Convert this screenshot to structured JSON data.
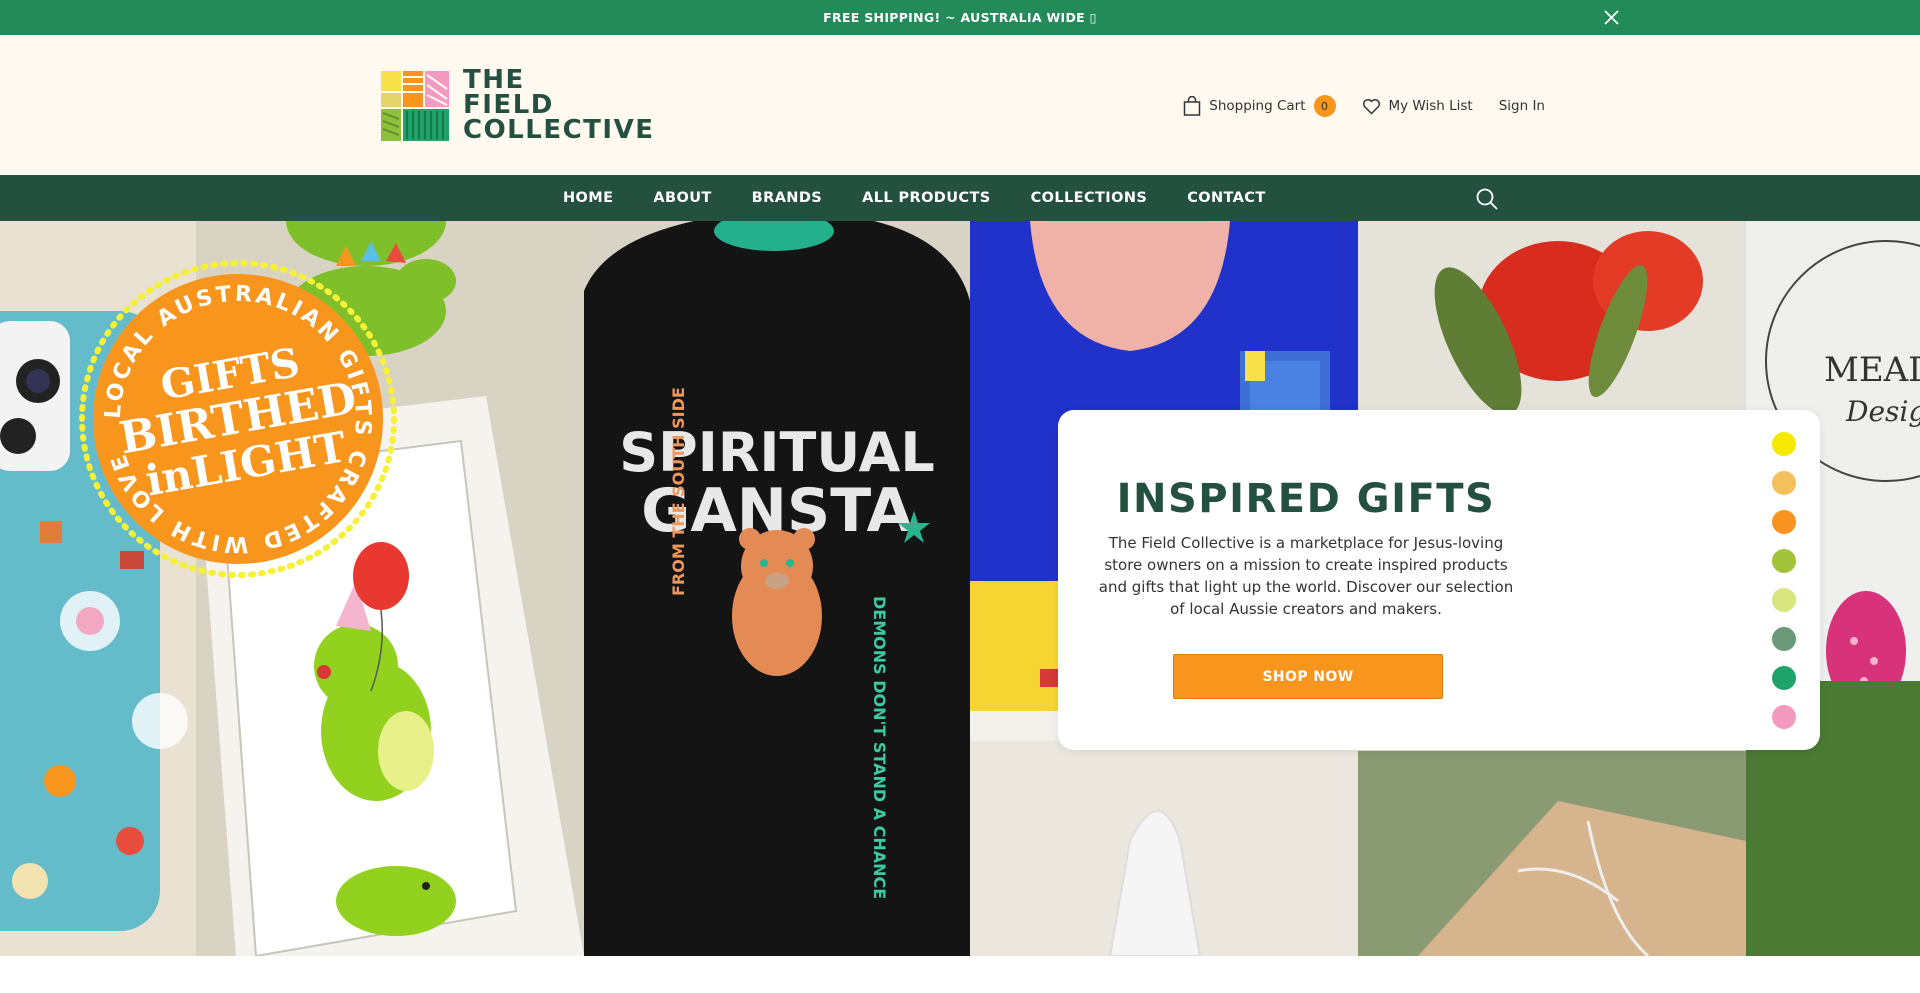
{
  "announcement": {
    "text": "FREE SHIPPING! ~ AUSTRALIA WIDE ▯"
  },
  "brand": {
    "line1": "THE",
    "line2": "FIELD",
    "line3": "COLLECTIVE"
  },
  "header": {
    "cart_label": "Shopping Cart",
    "cart_count": "0",
    "wishlist_label": "My Wish List",
    "signin_label": "Sign In"
  },
  "nav": {
    "items": [
      {
        "label": "HOME"
      },
      {
        "label": "ABOUT"
      },
      {
        "label": "BRANDS"
      },
      {
        "label": "ALL PRODUCTS"
      },
      {
        "label": "COLLECTIONS"
      },
      {
        "label": "CONTACT"
      }
    ]
  },
  "hero": {
    "badge_ring_text": "LOCAL AUSTRALIAN GIFTS CRAFTED WITH LOVE",
    "badge_line1": "GIFTS",
    "badge_line2": "BIRTHED",
    "badge_line3": "inLIGHT",
    "hoodie_line1": "SPIRITUAL",
    "hoodie_line2": "GANSTA",
    "hoodie_left": "FROM THE SOUTH SIDE",
    "hoodie_right": "DEMONS DON'T STAND A CHANCE",
    "sign_text": "MEAD",
    "sign_sub": "Desig",
    "title": "INSPIRED GIFTS",
    "description": "The Field Collective is a marketplace for Jesus-loving store owners on a mission to create inspired products and gifts that light up the world. Discover our selection of local Aussie creators and makers.",
    "cta_label": "SHOP NOW"
  },
  "colors": {
    "announcement_bg": "#238a5a",
    "header_bg": "#fff9f0",
    "nav_bg": "#23503f",
    "accent_orange": "#f7951d",
    "swatches": [
      "#f5ea00",
      "#f5c15c",
      "#f7931e",
      "#a3c43a",
      "#d9e57f",
      "#6c9a78",
      "#1fa36a",
      "#f49ac1"
    ]
  },
  "icons": {
    "close": "close-icon",
    "cart": "shopping-bag-icon",
    "wishlist": "heart-icon",
    "search": "search-icon"
  }
}
